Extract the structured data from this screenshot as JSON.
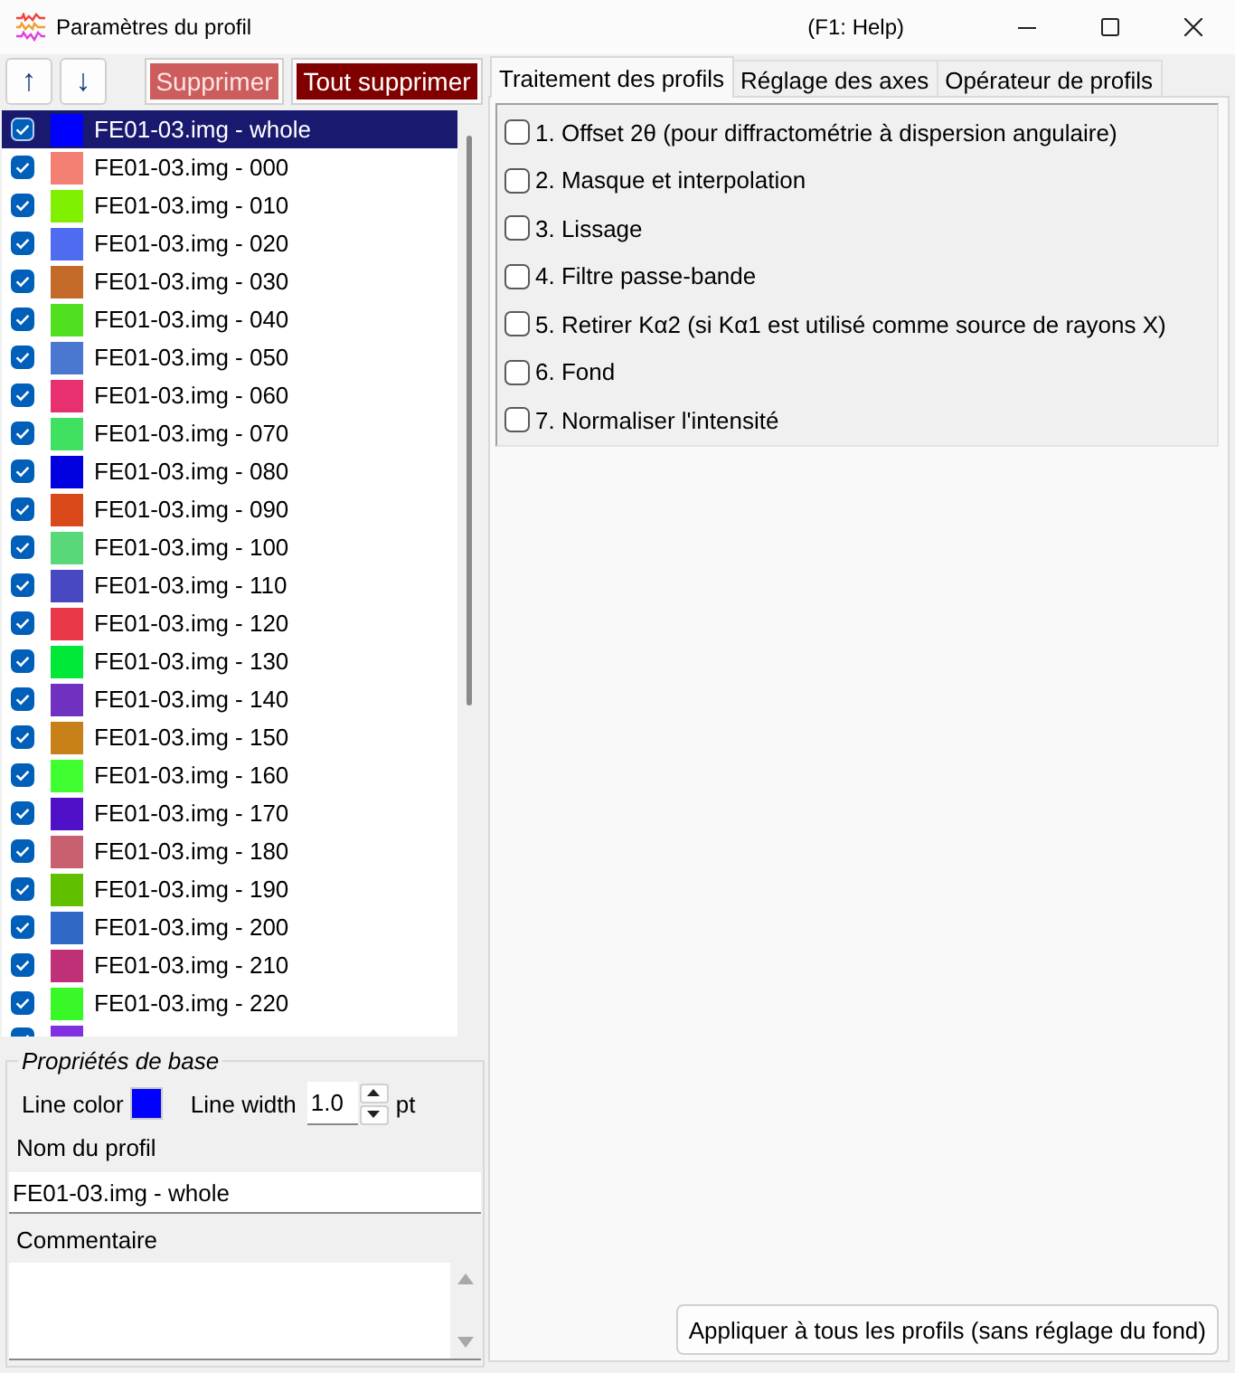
{
  "window": {
    "title": "Paramètres du profil",
    "help": "(F1: Help)"
  },
  "toolbar": {
    "buttons": [
      {
        "kind": "move_up",
        "label": "↑"
      },
      {
        "kind": "move_down",
        "label": "↓"
      },
      {
        "kind": "delete",
        "label": "Supprimer"
      },
      {
        "kind": "delete_all",
        "label": "Tout supprimer"
      }
    ]
  },
  "profiles": [
    {
      "kind": "row",
      "label": "FE01-03.img - whole",
      "color": "#0000ff",
      "checked": true,
      "selected": true
    },
    {
      "kind": "row",
      "label": "FE01-03.img - 000",
      "color": "#f47f73",
      "checked": true,
      "selected": false
    },
    {
      "kind": "row",
      "label": "FE01-03.img - 010",
      "color": "#7ff000",
      "checked": true,
      "selected": false
    },
    {
      "kind": "row",
      "label": "FE01-03.img - 020",
      "color": "#4f6bef",
      "checked": true,
      "selected": false
    },
    {
      "kind": "row",
      "label": "FE01-03.img - 030",
      "color": "#c46a28",
      "checked": true,
      "selected": false
    },
    {
      "kind": "row",
      "label": "FE01-03.img - 040",
      "color": "#50e020",
      "checked": true,
      "selected": false
    },
    {
      "kind": "row",
      "label": "FE01-03.img - 050",
      "color": "#4a78d0",
      "checked": true,
      "selected": false
    },
    {
      "kind": "row",
      "label": "FE01-03.img - 060",
      "color": "#e83070",
      "checked": true,
      "selected": false
    },
    {
      "kind": "row",
      "label": "FE01-03.img - 070",
      "color": "#40e060",
      "checked": true,
      "selected": false
    },
    {
      "kind": "row",
      "label": "FE01-03.img - 080",
      "color": "#0000e0",
      "checked": true,
      "selected": false
    },
    {
      "kind": "row",
      "label": "FE01-03.img - 090",
      "color": "#d84818",
      "checked": true,
      "selected": false
    },
    {
      "kind": "row",
      "label": "FE01-03.img - 100",
      "color": "#58d878",
      "checked": true,
      "selected": false
    },
    {
      "kind": "row",
      "label": "FE01-03.img - 110",
      "color": "#4848c0",
      "checked": true,
      "selected": false
    },
    {
      "kind": "row",
      "label": "FE01-03.img - 120",
      "color": "#e83848",
      "checked": true,
      "selected": false
    },
    {
      "kind": "row",
      "label": "FE01-03.img - 130",
      "color": "#00e838",
      "checked": true,
      "selected": false
    },
    {
      "kind": "row",
      "label": "FE01-03.img - 140",
      "color": "#7030c0",
      "checked": true,
      "selected": false
    },
    {
      "kind": "row",
      "label": "FE01-03.img - 150",
      "color": "#c88018",
      "checked": true,
      "selected": false
    },
    {
      "kind": "row",
      "label": "FE01-03.img - 160",
      "color": "#40ff30",
      "checked": true,
      "selected": false
    },
    {
      "kind": "row",
      "label": "FE01-03.img - 170",
      "color": "#5010c8",
      "checked": true,
      "selected": false
    },
    {
      "kind": "row",
      "label": "FE01-03.img - 180",
      "color": "#c86070",
      "checked": true,
      "selected": false
    },
    {
      "kind": "row",
      "label": "FE01-03.img - 190",
      "color": "#60c000",
      "checked": true,
      "selected": false
    },
    {
      "kind": "row",
      "label": "FE01-03.img - 200",
      "color": "#3068c8",
      "checked": true,
      "selected": false
    },
    {
      "kind": "row",
      "label": "FE01-03.img - 210",
      "color": "#c03078",
      "checked": true,
      "selected": false
    },
    {
      "kind": "row",
      "label": "FE01-03.img - 220",
      "color": "#38f828",
      "checked": true,
      "selected": false
    },
    {
      "kind": "clipped_row",
      "color": "#8030e0",
      "checked": true,
      "selected": false
    }
  ],
  "basic_properties": {
    "title": "Propriétés de base",
    "line_color": {
      "label": "Line color",
      "color": "#0000ff"
    },
    "line_width": {
      "label": "Line width",
      "value": "1.0",
      "unit": "pt"
    }
  },
  "profile_name": {
    "label": "Nom du profil",
    "value": "FE01-03.img - whole"
  },
  "comment": {
    "label": "Commentaire"
  },
  "tabs": [
    {
      "label": "Traitement des profils",
      "selected": true
    },
    {
      "label": "Réglage des axes",
      "selected": false
    },
    {
      "label": "Opérateur de profils",
      "selected": false
    }
  ],
  "processing_steps": [
    {
      "label": "1. Offset 2θ (pour diffractométrie à dispersion angulaire)",
      "checked": false
    },
    {
      "label": "2. Masque et interpolation",
      "checked": false
    },
    {
      "label": "3. Lissage",
      "checked": false
    },
    {
      "label": "4. Filtre passe-bande",
      "checked": false
    },
    {
      "label": "5. Retirer Kα2 (si Kα1 est utilisé comme source de rayons X)",
      "checked": false
    },
    {
      "label": "6. Fond",
      "checked": false
    },
    {
      "label": "7. Normaliser l'intensité",
      "checked": false
    }
  ],
  "apply_button": {
    "label": "Appliquer à tous les profils (sans réglage du fond)"
  }
}
